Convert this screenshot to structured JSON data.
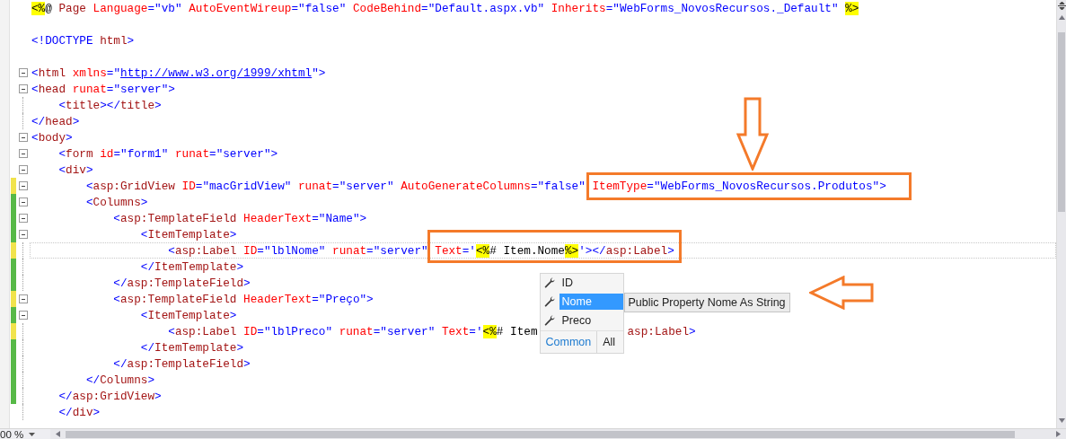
{
  "editor": {
    "lines": [
      {
        "kind": "code",
        "tokens": [
          {
            "kind": "server",
            "text": "<%"
          },
          {
            "kind": "plain",
            "text": "@"
          },
          {
            "kind": "tag",
            "text": " Page"
          },
          {
            "kind": "attr",
            "text": " Language"
          },
          {
            "kind": "delim",
            "text": "="
          },
          {
            "kind": "value",
            "text": "\"vb\""
          },
          {
            "kind": "attr",
            "text": " AutoEventWireup"
          },
          {
            "kind": "delim",
            "text": "="
          },
          {
            "kind": "value",
            "text": "\"false\""
          },
          {
            "kind": "attr",
            "text": " CodeBehind"
          },
          {
            "kind": "delim",
            "text": "="
          },
          {
            "kind": "value",
            "text": "\"Default.aspx.vb\""
          },
          {
            "kind": "attr",
            "text": " Inherits"
          },
          {
            "kind": "delim",
            "text": "="
          },
          {
            "kind": "value",
            "text": "\"WebForms_NovosRecursos._Default\" "
          },
          {
            "kind": "server",
            "text": "%>"
          }
        ]
      },
      {
        "kind": "blank"
      },
      {
        "kind": "code",
        "tokens": [
          {
            "kind": "delim",
            "text": "<!DOCTYPE"
          },
          {
            "kind": "tag",
            "text": " html"
          },
          {
            "kind": "delim",
            "text": ">"
          }
        ]
      },
      {
        "kind": "blank"
      },
      {
        "kind": "code",
        "collapsible": true,
        "tokens": [
          {
            "kind": "delim",
            "text": "<"
          },
          {
            "kind": "tag",
            "text": "html"
          },
          {
            "kind": "attr",
            "text": " xmlns"
          },
          {
            "kind": "delim",
            "text": "=\""
          },
          {
            "kind": "link",
            "text": "http://www.w3.org/1999/xhtml"
          },
          {
            "kind": "delim",
            "text": "\">"
          }
        ]
      },
      {
        "kind": "code",
        "collapsible": true,
        "tokens": [
          {
            "kind": "delim",
            "text": "<"
          },
          {
            "kind": "tag",
            "text": "head"
          },
          {
            "kind": "attr",
            "text": " runat"
          },
          {
            "kind": "delim",
            "text": "="
          },
          {
            "kind": "value",
            "text": "\"server\""
          },
          {
            "kind": "delim",
            "text": ">"
          }
        ]
      },
      {
        "kind": "code",
        "collapsible": false,
        "tokens": [
          {
            "kind": "delim",
            "text": "    <"
          },
          {
            "kind": "tag",
            "text": "title"
          },
          {
            "kind": "delim",
            "text": "></"
          },
          {
            "kind": "tag",
            "text": "title"
          },
          {
            "kind": "delim",
            "text": ">"
          }
        ]
      },
      {
        "kind": "code",
        "collapsible": false,
        "tokens": [
          {
            "kind": "delim",
            "text": "</"
          },
          {
            "kind": "tag",
            "text": "head"
          },
          {
            "kind": "delim",
            "text": ">"
          }
        ]
      },
      {
        "kind": "code",
        "collapsible": true,
        "tokens": [
          {
            "kind": "delim",
            "text": "<"
          },
          {
            "kind": "tag",
            "text": "body"
          },
          {
            "kind": "delim",
            "text": ">"
          }
        ]
      },
      {
        "kind": "code",
        "collapsible": true,
        "tokens": [
          {
            "kind": "delim",
            "text": "    <"
          },
          {
            "kind": "tag",
            "text": "form"
          },
          {
            "kind": "attr",
            "text": " id"
          },
          {
            "kind": "delim",
            "text": "="
          },
          {
            "kind": "value",
            "text": "\"form1\""
          },
          {
            "kind": "attr",
            "text": " runat"
          },
          {
            "kind": "delim",
            "text": "="
          },
          {
            "kind": "value",
            "text": "\"server\""
          },
          {
            "kind": "delim",
            "text": ">"
          }
        ]
      },
      {
        "kind": "code",
        "collapsible": true,
        "tokens": [
          {
            "kind": "delim",
            "text": "    <"
          },
          {
            "kind": "tag",
            "text": "div"
          },
          {
            "kind": "delim",
            "text": ">"
          }
        ]
      },
      {
        "kind": "code",
        "collapsible": true,
        "color": "#f1e34c",
        "tokens": [
          {
            "kind": "delim",
            "text": "        <"
          },
          {
            "kind": "tag",
            "text": "asp:GridView"
          },
          {
            "kind": "attr",
            "text": " ID"
          },
          {
            "kind": "delim",
            "text": "="
          },
          {
            "kind": "value",
            "text": "\"macGridView\""
          },
          {
            "kind": "attr",
            "text": " runat"
          },
          {
            "kind": "delim",
            "text": "="
          },
          {
            "kind": "value",
            "text": "\"server\""
          },
          {
            "kind": "attr",
            "text": " AutoGenerateColumns"
          },
          {
            "kind": "delim",
            "text": "="
          },
          {
            "kind": "value",
            "text": "\"false\""
          },
          {
            "kind": "attr",
            "text": " ItemType"
          },
          {
            "kind": "delim",
            "text": "="
          },
          {
            "kind": "value",
            "text": "\"WebForms_NovosRecursos.Produtos\""
          },
          {
            "kind": "delim",
            "text": ">"
          }
        ]
      },
      {
        "kind": "code",
        "collapsible": true,
        "color": "#57b947",
        "tokens": [
          {
            "kind": "delim",
            "text": "        <"
          },
          {
            "kind": "tag",
            "text": "Columns"
          },
          {
            "kind": "delim",
            "text": ">"
          }
        ]
      },
      {
        "kind": "code",
        "collapsible": true,
        "color": "#57b947",
        "tokens": [
          {
            "kind": "delim",
            "text": "            <"
          },
          {
            "kind": "tag",
            "text": "asp:TemplateField"
          },
          {
            "kind": "attr",
            "text": " HeaderText"
          },
          {
            "kind": "delim",
            "text": "="
          },
          {
            "kind": "value",
            "text": "\"Name\""
          },
          {
            "kind": "delim",
            "text": ">"
          }
        ]
      },
      {
        "kind": "code",
        "collapsible": true,
        "color": "#57b947",
        "tokens": [
          {
            "kind": "delim",
            "text": "                <"
          },
          {
            "kind": "tag",
            "text": "ItemTemplate"
          },
          {
            "kind": "delim",
            "text": ">"
          }
        ]
      },
      {
        "kind": "code",
        "collapsible": false,
        "color": "#f1e34c",
        "current": true,
        "tokens": [
          {
            "kind": "delim",
            "text": "                    <"
          },
          {
            "kind": "tag",
            "text": "asp:Label"
          },
          {
            "kind": "attr",
            "text": " ID"
          },
          {
            "kind": "delim",
            "text": "="
          },
          {
            "kind": "value",
            "text": "\"lblNome\""
          },
          {
            "kind": "attr",
            "text": " runat"
          },
          {
            "kind": "delim",
            "text": "="
          },
          {
            "kind": "value",
            "text": "\"server\""
          },
          {
            "kind": "attr",
            "text": " Text"
          },
          {
            "kind": "delim",
            "text": "='"
          },
          {
            "kind": "server",
            "text": "<%"
          },
          {
            "kind": "plain",
            "text": "# Item.Nome"
          },
          {
            "kind": "server",
            "text": "%>"
          },
          {
            "kind": "delim",
            "text": "'></"
          },
          {
            "kind": "tag",
            "text": "asp:Label"
          },
          {
            "kind": "delim",
            "text": ">"
          }
        ]
      },
      {
        "kind": "code",
        "collapsible": false,
        "color": "#57b947",
        "tokens": [
          {
            "kind": "delim",
            "text": "                </"
          },
          {
            "kind": "tag",
            "text": "ItemTemplate"
          },
          {
            "kind": "delim",
            "text": ">"
          }
        ]
      },
      {
        "kind": "code",
        "collapsible": false,
        "color": "#57b947",
        "tokens": [
          {
            "kind": "delim",
            "text": "            </"
          },
          {
            "kind": "tag",
            "text": "asp:TemplateField"
          },
          {
            "kind": "delim",
            "text": ">"
          }
        ]
      },
      {
        "kind": "code",
        "collapsible": true,
        "color": "#f1e34c",
        "tokens": [
          {
            "kind": "delim",
            "text": "            <"
          },
          {
            "kind": "tag",
            "text": "asp:TemplateField"
          },
          {
            "kind": "attr",
            "text": " HeaderText"
          },
          {
            "kind": "delim",
            "text": "="
          },
          {
            "kind": "value",
            "text": "\"Preço\""
          },
          {
            "kind": "delim",
            "text": ">"
          }
        ]
      },
      {
        "kind": "code",
        "collapsible": true,
        "color": "#57b947",
        "tokens": [
          {
            "kind": "delim",
            "text": "                <"
          },
          {
            "kind": "tag",
            "text": "ItemTemplate"
          },
          {
            "kind": "delim",
            "text": ">"
          }
        ]
      },
      {
        "kind": "code",
        "collapsible": false,
        "color": "#f1e34c",
        "tokens": [
          {
            "kind": "delim",
            "text": "                    <"
          },
          {
            "kind": "tag",
            "text": "asp:Label"
          },
          {
            "kind": "attr",
            "text": " ID"
          },
          {
            "kind": "delim",
            "text": "="
          },
          {
            "kind": "value",
            "text": "\"lblPreco\""
          },
          {
            "kind": "attr",
            "text": " runat"
          },
          {
            "kind": "delim",
            "text": "="
          },
          {
            "kind": "value",
            "text": "\"server\""
          },
          {
            "kind": "attr",
            "text": " Text"
          },
          {
            "kind": "delim",
            "text": "='"
          },
          {
            "kind": "server",
            "text": "<%"
          },
          {
            "kind": "plain",
            "text": "# Item"
          }
        ],
        "tail": [
          {
            "kind": "tag",
            "text": "asp:Label"
          },
          {
            "kind": "delim",
            "text": ">"
          }
        ]
      },
      {
        "kind": "code",
        "collapsible": false,
        "color": "#57b947",
        "tokens": [
          {
            "kind": "delim",
            "text": "                </"
          },
          {
            "kind": "tag",
            "text": "ItemTemplate"
          },
          {
            "kind": "delim",
            "text": ">"
          }
        ]
      },
      {
        "kind": "code",
        "collapsible": false,
        "color": "#57b947",
        "tokens": [
          {
            "kind": "delim",
            "text": "            </"
          },
          {
            "kind": "tag",
            "text": "asp:TemplateField"
          },
          {
            "kind": "delim",
            "text": ">"
          }
        ]
      },
      {
        "kind": "code",
        "collapsible": false,
        "color": "#57b947",
        "tokens": [
          {
            "kind": "delim",
            "text": "        </"
          },
          {
            "kind": "tag",
            "text": "Columns"
          },
          {
            "kind": "delim",
            "text": ">"
          }
        ]
      },
      {
        "kind": "code",
        "collapsible": false,
        "color": "#57b947",
        "tokens": [
          {
            "kind": "delim",
            "text": "    </"
          },
          {
            "kind": "tag",
            "text": "asp:GridView"
          },
          {
            "kind": "delim",
            "text": ">"
          }
        ]
      },
      {
        "kind": "code",
        "collapsible": false,
        "tokens": [
          {
            "kind": "delim",
            "text": "    </"
          },
          {
            "kind": "tag",
            "text": "div"
          },
          {
            "kind": "delim",
            "text": ">"
          }
        ]
      }
    ]
  },
  "completion": {
    "items": [
      {
        "label": "ID",
        "selected": false
      },
      {
        "label": "Nome",
        "selected": true
      },
      {
        "label": "Preco",
        "selected": false
      }
    ],
    "tabs": [
      {
        "label": "Common",
        "selected": true
      },
      {
        "label": "All",
        "selected": false
      }
    ],
    "quick_info": "Public Property Nome As String"
  },
  "zoom": "00 %"
}
